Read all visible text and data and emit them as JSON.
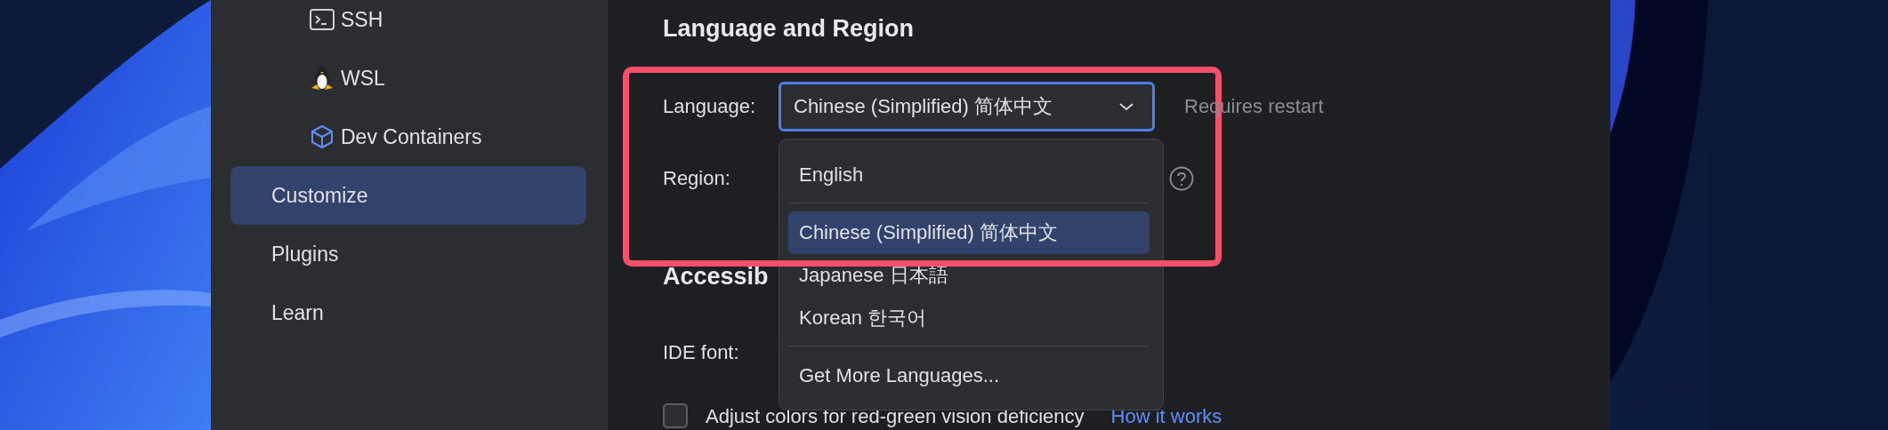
{
  "sidebar": {
    "sub_items": [
      {
        "label": "SSH",
        "selected": false
      },
      {
        "label": "WSL",
        "selected": false
      },
      {
        "label": "Dev Containers",
        "selected": false
      }
    ],
    "items": [
      {
        "label": "Customize",
        "selected": true
      },
      {
        "label": "Plugins",
        "selected": false
      },
      {
        "label": "Learn",
        "selected": false
      }
    ]
  },
  "language_and_region": {
    "heading": "Language and Region",
    "language": {
      "label": "Language:",
      "value": "Chinese (Simplified) 简体中文",
      "hint": "Requires restart"
    },
    "region": {
      "label": "Region:"
    }
  },
  "language_menu": {
    "items": [
      {
        "label": "English",
        "selected": false,
        "separator_after": true
      },
      {
        "label": "Chinese (Simplified) 简体中文",
        "selected": true,
        "separator_after": false
      },
      {
        "label": "Japanese 日本語",
        "selected": false,
        "separator_after": false
      },
      {
        "label": "Korean 한국어",
        "selected": false,
        "separator_after": true
      },
      {
        "label": "Get More Languages...",
        "selected": false,
        "separator_after": false
      }
    ]
  },
  "accessibility": {
    "heading": "Accessib",
    "font_label": "IDE font:",
    "checkbox": {
      "label": "Adjust colors for red-green vision deficiency",
      "checked": false
    },
    "link": "How it works"
  }
}
